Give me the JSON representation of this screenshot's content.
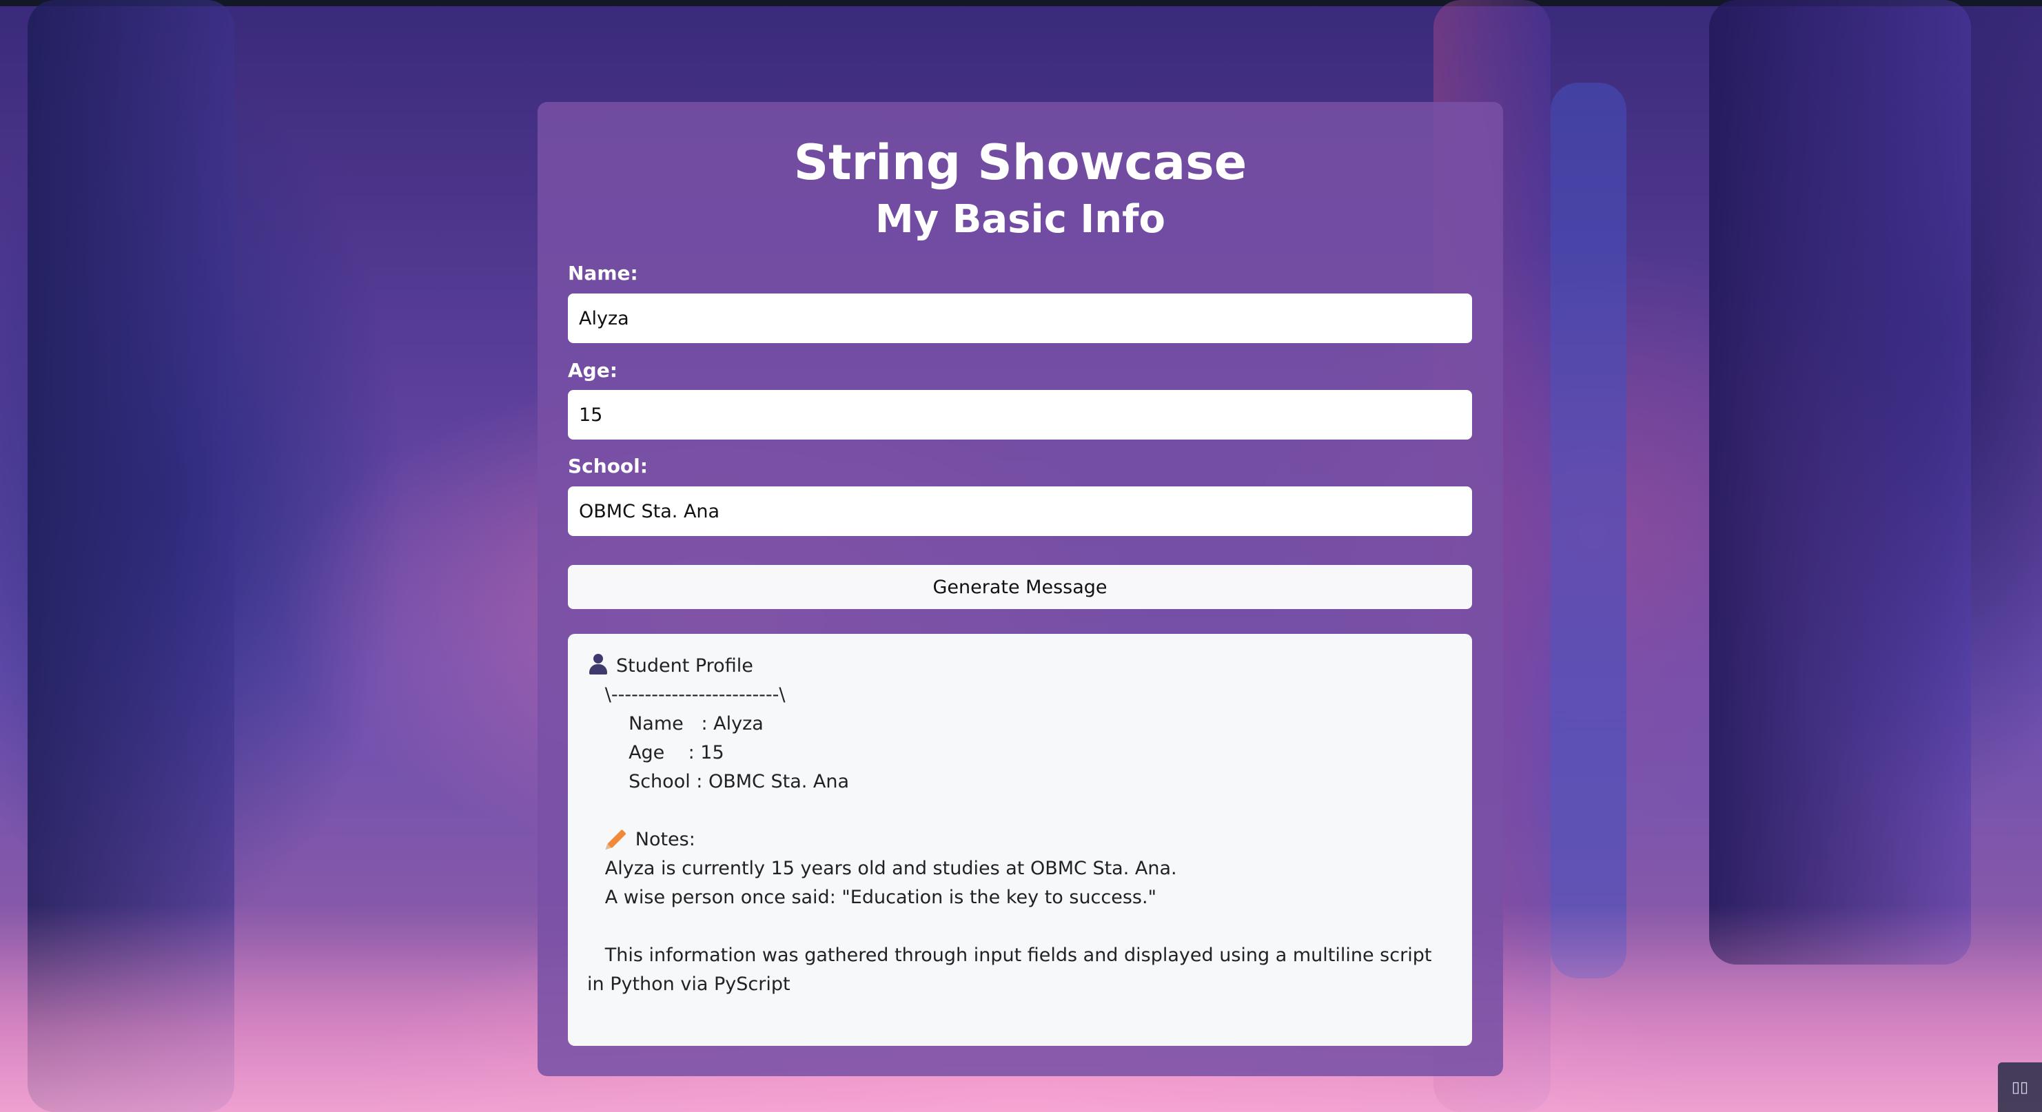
{
  "header": {
    "title": "String Showcase",
    "subtitle": "My Basic Info"
  },
  "form": {
    "name_label": "Name:",
    "name_value": "Alyza",
    "age_label": "Age:",
    "age_value": "15",
    "school_label": "School:",
    "school_value": "OBMC Sta. Ana",
    "generate_label": "Generate Message"
  },
  "output": {
    "profile_title": "Student Profile",
    "divider": "   \\-------------------------\\",
    "name_line": "       Name   : Alyza",
    "age_line": "       Age    : 15",
    "school_line": "       School : OBMC Sta. Ana",
    "notes_title": "Notes:",
    "notes_line1": "   Alyza is currently 15 years old and studies at OBMC Sta. Ana.",
    "notes_line2": "   A wise person once said: \"Education is the key to success.\"",
    "footer_text": "   This information was gathered through input fields and displayed using a multiline script in Python via PyScript"
  },
  "icons": {
    "profile": "profile-icon",
    "notes": "pencil-icon",
    "corner": "layout-toggle-icon"
  },
  "colors": {
    "card": "#7850a5",
    "input_bg": "#ffffff",
    "output_bg": "#f7f8fa",
    "title_text": "#ffffff"
  }
}
